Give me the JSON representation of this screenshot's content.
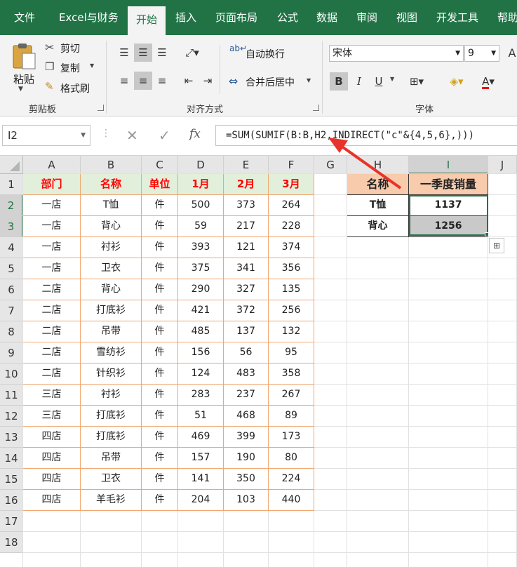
{
  "ribbon_tabs": [
    "文件",
    "Excel与财务",
    "开始",
    "插入",
    "页面布局",
    "公式",
    "数据",
    "审阅",
    "视图",
    "开发工具",
    "帮助"
  ],
  "clipboard": {
    "paste": "粘贴",
    "cut": "剪切",
    "copy": "复制",
    "format_painter": "格式刷",
    "group_label": "剪贴板"
  },
  "alignment": {
    "wrap": "自动换行",
    "merge": "合并后居中",
    "group_label": "对齐方式"
  },
  "font": {
    "name": "宋体",
    "size": "9",
    "bold": "B",
    "italic": "I",
    "underline": "U",
    "group_label": "字体",
    "grow": "A",
    "shrink": "A"
  },
  "formula_bar": {
    "name_box": "I2",
    "fx": "fx",
    "formula": "=SUM(SUMIF(B:B,H2,INDIRECT(\"c\"&{4,5,6},)))"
  },
  "columns": [
    "A",
    "B",
    "C",
    "D",
    "E",
    "F",
    "G",
    "H",
    "I",
    "J"
  ],
  "rows": [
    "1",
    "2",
    "3",
    "4",
    "5",
    "6",
    "7",
    "8",
    "9",
    "10",
    "11",
    "12",
    "13",
    "14",
    "15",
    "16",
    "17",
    "18"
  ],
  "table_header": [
    "部门",
    "名称",
    "单位",
    "1月",
    "2月",
    "3月"
  ],
  "table_rows": [
    [
      "一店",
      "T恤",
      "件",
      "500",
      "373",
      "264"
    ],
    [
      "一店",
      "背心",
      "件",
      "59",
      "217",
      "228"
    ],
    [
      "一店",
      "衬衫",
      "件",
      "393",
      "121",
      "374"
    ],
    [
      "一店",
      "卫衣",
      "件",
      "375",
      "341",
      "356"
    ],
    [
      "二店",
      "背心",
      "件",
      "290",
      "327",
      "135"
    ],
    [
      "二店",
      "打底衫",
      "件",
      "421",
      "372",
      "256"
    ],
    [
      "二店",
      "吊带",
      "件",
      "485",
      "137",
      "132"
    ],
    [
      "二店",
      "雪纺衫",
      "件",
      "156",
      "56",
      "95"
    ],
    [
      "二店",
      "针织衫",
      "件",
      "124",
      "483",
      "358"
    ],
    [
      "三店",
      "衬衫",
      "件",
      "283",
      "237",
      "267"
    ],
    [
      "三店",
      "打底衫",
      "件",
      "51",
      "468",
      "89"
    ],
    [
      "四店",
      "打底衫",
      "件",
      "469",
      "399",
      "173"
    ],
    [
      "四店",
      "吊带",
      "件",
      "157",
      "190",
      "80"
    ],
    [
      "四店",
      "卫衣",
      "件",
      "141",
      "350",
      "224"
    ],
    [
      "四店",
      "羊毛衫",
      "件",
      "204",
      "103",
      "440"
    ]
  ],
  "summary_header": [
    "名称",
    "一季度销量"
  ],
  "summary_rows": [
    [
      "T恤",
      "1137"
    ],
    [
      "背心",
      "1256"
    ]
  ],
  "colors": {
    "ribbon": "#217346",
    "header_fill": "#e2efda",
    "header_text": "#ff0000",
    "summary_fill": "#f8cbad",
    "table_border": "#f0a66e",
    "arrow": "#e8332a"
  }
}
